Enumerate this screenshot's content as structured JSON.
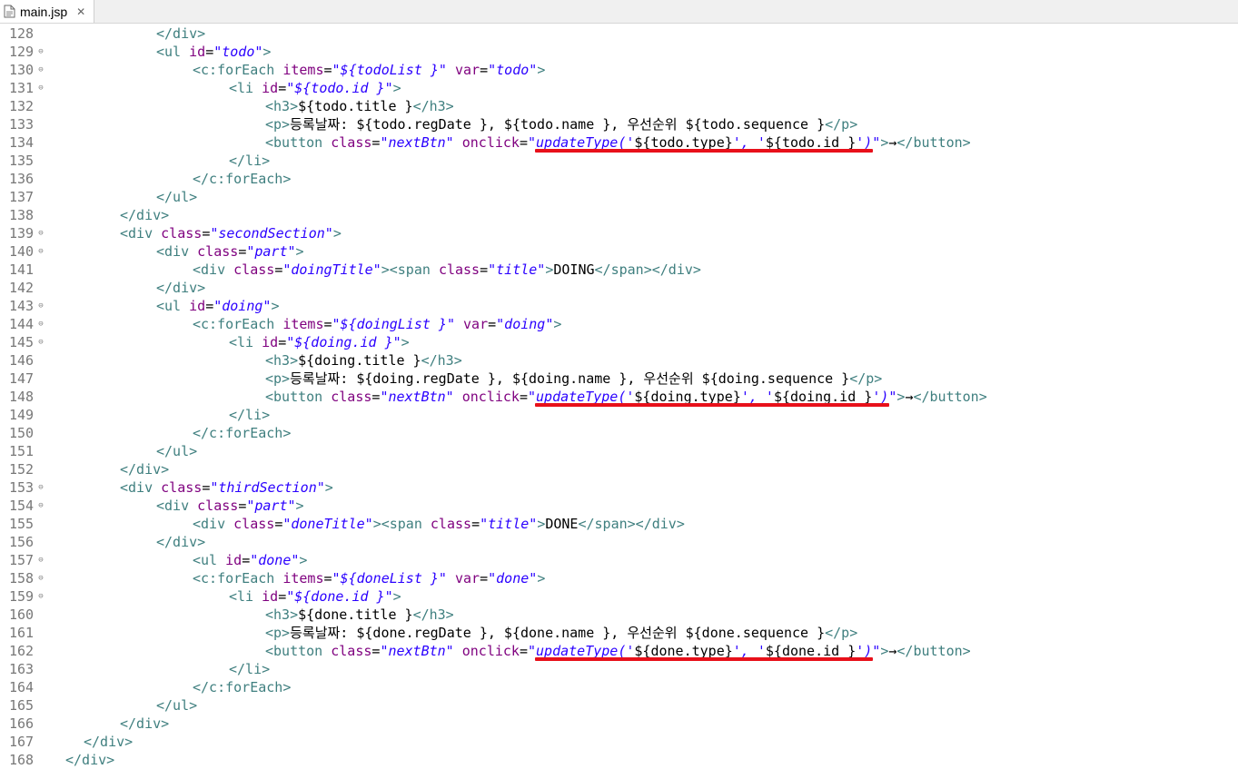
{
  "tab": {
    "filename": "main.jsp",
    "close_glyph": "✕",
    "file_icon": "jsp-file-icon"
  },
  "colors": {
    "tag": "#3f7f7f",
    "attr": "#7f007f",
    "string": "#2a00ff",
    "text": "#000000",
    "underline": "#e8101a",
    "line_number": "#787878"
  },
  "lines": [
    {
      "n": "128",
      "fold": false,
      "indent": 3,
      "segs": [
        [
          "tag",
          "</div>"
        ]
      ]
    },
    {
      "n": "129",
      "fold": true,
      "indent": 3,
      "segs": [
        [
          "tag",
          "<ul "
        ],
        [
          "attr",
          "id"
        ],
        [
          "text",
          "="
        ],
        [
          "str",
          "\"todo\""
        ],
        [
          "tag",
          ">"
        ]
      ]
    },
    {
      "n": "130",
      "fold": true,
      "indent": 4,
      "segs": [
        [
          "tag",
          "<c:forEach "
        ],
        [
          "attr",
          "items"
        ],
        [
          "text",
          "="
        ],
        [
          "str",
          "\"${todoList }\""
        ],
        [
          "text",
          " "
        ],
        [
          "attr",
          "var"
        ],
        [
          "text",
          "="
        ],
        [
          "str",
          "\"todo\""
        ],
        [
          "tag",
          ">"
        ]
      ]
    },
    {
      "n": "131",
      "fold": true,
      "indent": 5,
      "segs": [
        [
          "tag",
          "<li "
        ],
        [
          "attr",
          "id"
        ],
        [
          "text",
          "="
        ],
        [
          "str",
          "\"${todo.id }\""
        ],
        [
          "tag",
          ">"
        ]
      ]
    },
    {
      "n": "132",
      "fold": false,
      "indent": 6,
      "segs": [
        [
          "tag",
          "<h3>"
        ],
        [
          "text",
          "${todo.title }"
        ],
        [
          "tag",
          "</h3>"
        ]
      ]
    },
    {
      "n": "133",
      "fold": false,
      "indent": 6,
      "segs": [
        [
          "tag",
          "<p>"
        ],
        [
          "text",
          "등록날짜: ${todo.regDate }, ${todo.name }, 우선순위 ${todo.sequence }"
        ],
        [
          "tag",
          "</p>"
        ]
      ]
    },
    {
      "n": "134",
      "fold": false,
      "indent": 6,
      "segs": [
        [
          "tag",
          "<button "
        ],
        [
          "attr",
          "class"
        ],
        [
          "text",
          "="
        ],
        [
          "str",
          "\"nextBtn\""
        ],
        [
          "text",
          " "
        ],
        [
          "attr",
          "onclick"
        ],
        [
          "text",
          "="
        ],
        [
          "str",
          "\"updateType('"
        ],
        [
          "text",
          "${todo.type}"
        ],
        [
          "str",
          "', '"
        ],
        [
          "text",
          "${todo.id }"
        ],
        [
          "str",
          "')\""
        ],
        [
          "tag",
          ">"
        ],
        [
          "text",
          "→"
        ],
        [
          "tag",
          "</button>"
        ]
      ]
    },
    {
      "n": "135",
      "fold": false,
      "indent": 5,
      "segs": [
        [
          "tag",
          "</li>"
        ]
      ]
    },
    {
      "n": "136",
      "fold": false,
      "indent": 4,
      "segs": [
        [
          "tag",
          "</c:forEach>"
        ]
      ]
    },
    {
      "n": "137",
      "fold": false,
      "indent": 3,
      "segs": [
        [
          "tag",
          "</ul>"
        ]
      ]
    },
    {
      "n": "138",
      "fold": false,
      "indent": 2,
      "segs": [
        [
          "tag",
          "</div>"
        ]
      ]
    },
    {
      "n": "139",
      "fold": true,
      "indent": 2,
      "segs": [
        [
          "tag",
          "<div "
        ],
        [
          "attr",
          "class"
        ],
        [
          "text",
          "="
        ],
        [
          "str",
          "\"secondSection\""
        ],
        [
          "tag",
          ">"
        ]
      ]
    },
    {
      "n": "140",
      "fold": true,
      "indent": 3,
      "segs": [
        [
          "tag",
          "<div "
        ],
        [
          "attr",
          "class"
        ],
        [
          "text",
          "="
        ],
        [
          "str",
          "\"part\""
        ],
        [
          "tag",
          ">"
        ]
      ]
    },
    {
      "n": "141",
      "fold": false,
      "indent": 4,
      "segs": [
        [
          "tag",
          "<div "
        ],
        [
          "attr",
          "class"
        ],
        [
          "text",
          "="
        ],
        [
          "str",
          "\"doingTitle\""
        ],
        [
          "tag",
          "><span "
        ],
        [
          "attr",
          "class"
        ],
        [
          "text",
          "="
        ],
        [
          "str",
          "\"title\""
        ],
        [
          "tag",
          ">"
        ],
        [
          "text",
          "DOING"
        ],
        [
          "tag",
          "</span></div>"
        ]
      ]
    },
    {
      "n": "142",
      "fold": false,
      "indent": 3,
      "segs": [
        [
          "tag",
          "</div>"
        ]
      ]
    },
    {
      "n": "143",
      "fold": true,
      "indent": 3,
      "segs": [
        [
          "tag",
          "<ul "
        ],
        [
          "attr",
          "id"
        ],
        [
          "text",
          "="
        ],
        [
          "str",
          "\"doing\""
        ],
        [
          "tag",
          ">"
        ]
      ]
    },
    {
      "n": "144",
      "fold": true,
      "indent": 4,
      "segs": [
        [
          "tag",
          "<c:forEach "
        ],
        [
          "attr",
          "items"
        ],
        [
          "text",
          "="
        ],
        [
          "str",
          "\"${doingList }\""
        ],
        [
          "text",
          " "
        ],
        [
          "attr",
          "var"
        ],
        [
          "text",
          "="
        ],
        [
          "str",
          "\"doing\""
        ],
        [
          "tag",
          ">"
        ]
      ]
    },
    {
      "n": "145",
      "fold": true,
      "indent": 5,
      "segs": [
        [
          "tag",
          "<li "
        ],
        [
          "attr",
          "id"
        ],
        [
          "text",
          "="
        ],
        [
          "str",
          "\"${doing.id }\""
        ],
        [
          "tag",
          ">"
        ]
      ]
    },
    {
      "n": "146",
      "fold": false,
      "indent": 6,
      "segs": [
        [
          "tag",
          "<h3>"
        ],
        [
          "text",
          "${doing.title }"
        ],
        [
          "tag",
          "</h3>"
        ]
      ]
    },
    {
      "n": "147",
      "fold": false,
      "indent": 6,
      "segs": [
        [
          "tag",
          "<p>"
        ],
        [
          "text",
          "등록날짜: ${doing.regDate }, ${doing.name }, 우선순위 ${doing.sequence }"
        ],
        [
          "tag",
          "</p>"
        ]
      ]
    },
    {
      "n": "148",
      "fold": false,
      "indent": 6,
      "segs": [
        [
          "tag",
          "<button "
        ],
        [
          "attr",
          "class"
        ],
        [
          "text",
          "="
        ],
        [
          "str",
          "\"nextBtn\""
        ],
        [
          "text",
          " "
        ],
        [
          "attr",
          "onclick"
        ],
        [
          "text",
          "="
        ],
        [
          "str",
          "\"updateType('"
        ],
        [
          "text",
          "${doing.type}"
        ],
        [
          "str",
          "', '"
        ],
        [
          "text",
          "${doing.id }"
        ],
        [
          "str",
          "')\""
        ],
        [
          "tag",
          ">"
        ],
        [
          "text",
          "→"
        ],
        [
          "tag",
          "</button>"
        ]
      ]
    },
    {
      "n": "149",
      "fold": false,
      "indent": 5,
      "segs": [
        [
          "tag",
          "</li>"
        ]
      ]
    },
    {
      "n": "150",
      "fold": false,
      "indent": 4,
      "segs": [
        [
          "tag",
          "</c:forEach>"
        ]
      ]
    },
    {
      "n": "151",
      "fold": false,
      "indent": 3,
      "segs": [
        [
          "tag",
          "</ul>"
        ]
      ]
    },
    {
      "n": "152",
      "fold": false,
      "indent": 2,
      "segs": [
        [
          "tag",
          "</div>"
        ]
      ]
    },
    {
      "n": "153",
      "fold": true,
      "indent": 2,
      "segs": [
        [
          "tag",
          "<div "
        ],
        [
          "attr",
          "class"
        ],
        [
          "text",
          "="
        ],
        [
          "str",
          "\"thirdSection\""
        ],
        [
          "tag",
          ">"
        ]
      ]
    },
    {
      "n": "154",
      "fold": true,
      "indent": 3,
      "segs": [
        [
          "tag",
          "<div "
        ],
        [
          "attr",
          "class"
        ],
        [
          "text",
          "="
        ],
        [
          "str",
          "\"part\""
        ],
        [
          "tag",
          ">"
        ]
      ]
    },
    {
      "n": "155",
      "fold": false,
      "indent": 4,
      "segs": [
        [
          "tag",
          "<div "
        ],
        [
          "attr",
          "class"
        ],
        [
          "text",
          "="
        ],
        [
          "str",
          "\"doneTitle\""
        ],
        [
          "tag",
          "><span "
        ],
        [
          "attr",
          "class"
        ],
        [
          "text",
          "="
        ],
        [
          "str",
          "\"title\""
        ],
        [
          "tag",
          ">"
        ],
        [
          "text",
          "DONE"
        ],
        [
          "tag",
          "</span></div>"
        ]
      ]
    },
    {
      "n": "156",
      "fold": false,
      "indent": 3,
      "segs": [
        [
          "tag",
          "</div>"
        ]
      ]
    },
    {
      "n": "157",
      "fold": true,
      "indent": 4,
      "segs": [
        [
          "tag",
          "<ul "
        ],
        [
          "attr",
          "id"
        ],
        [
          "text",
          "="
        ],
        [
          "str",
          "\"done\""
        ],
        [
          "tag",
          ">"
        ]
      ]
    },
    {
      "n": "158",
      "fold": true,
      "indent": 4,
      "segs": [
        [
          "tag",
          "<c:forEach "
        ],
        [
          "attr",
          "items"
        ],
        [
          "text",
          "="
        ],
        [
          "str",
          "\"${doneList }\""
        ],
        [
          "text",
          " "
        ],
        [
          "attr",
          "var"
        ],
        [
          "text",
          "="
        ],
        [
          "str",
          "\"done\""
        ],
        [
          "tag",
          ">"
        ]
      ]
    },
    {
      "n": "159",
      "fold": true,
      "indent": 5,
      "segs": [
        [
          "tag",
          "<li "
        ],
        [
          "attr",
          "id"
        ],
        [
          "text",
          "="
        ],
        [
          "str",
          "\"${done.id }\""
        ],
        [
          "tag",
          ">"
        ]
      ]
    },
    {
      "n": "160",
      "fold": false,
      "indent": 6,
      "segs": [
        [
          "tag",
          "<h3>"
        ],
        [
          "text",
          "${done.title }"
        ],
        [
          "tag",
          "</h3>"
        ]
      ]
    },
    {
      "n": "161",
      "fold": false,
      "indent": 6,
      "segs": [
        [
          "tag",
          "<p>"
        ],
        [
          "text",
          "등록날짜: ${done.regDate }, ${done.name }, 우선순위 ${done.sequence }"
        ],
        [
          "tag",
          "</p>"
        ]
      ]
    },
    {
      "n": "162",
      "fold": false,
      "indent": 6,
      "segs": [
        [
          "tag",
          "<button "
        ],
        [
          "attr",
          "class"
        ],
        [
          "text",
          "="
        ],
        [
          "str",
          "\"nextBtn\""
        ],
        [
          "text",
          " "
        ],
        [
          "attr",
          "onclick"
        ],
        [
          "text",
          "="
        ],
        [
          "str",
          "\"updateType('"
        ],
        [
          "text",
          "${done.type}"
        ],
        [
          "str",
          "', '"
        ],
        [
          "text",
          "${done.id }"
        ],
        [
          "str",
          "')\""
        ],
        [
          "tag",
          ">"
        ],
        [
          "text",
          "→"
        ],
        [
          "tag",
          "</button>"
        ]
      ]
    },
    {
      "n": "163",
      "fold": false,
      "indent": 5,
      "segs": [
        [
          "tag",
          "</li>"
        ]
      ]
    },
    {
      "n": "164",
      "fold": false,
      "indent": 4,
      "segs": [
        [
          "tag",
          "</c:forEach>"
        ]
      ]
    },
    {
      "n": "165",
      "fold": false,
      "indent": 3,
      "segs": [
        [
          "tag",
          "</ul>"
        ]
      ]
    },
    {
      "n": "166",
      "fold": false,
      "indent": 2,
      "segs": [
        [
          "tag",
          "</div>"
        ]
      ]
    },
    {
      "n": "167",
      "fold": false,
      "indent": 1,
      "segs": [
        [
          "tag",
          "</div>"
        ]
      ]
    },
    {
      "n": "168",
      "fold": false,
      "indent": 0.5,
      "segs": [
        [
          "tag",
          "</div>"
        ]
      ]
    }
  ]
}
